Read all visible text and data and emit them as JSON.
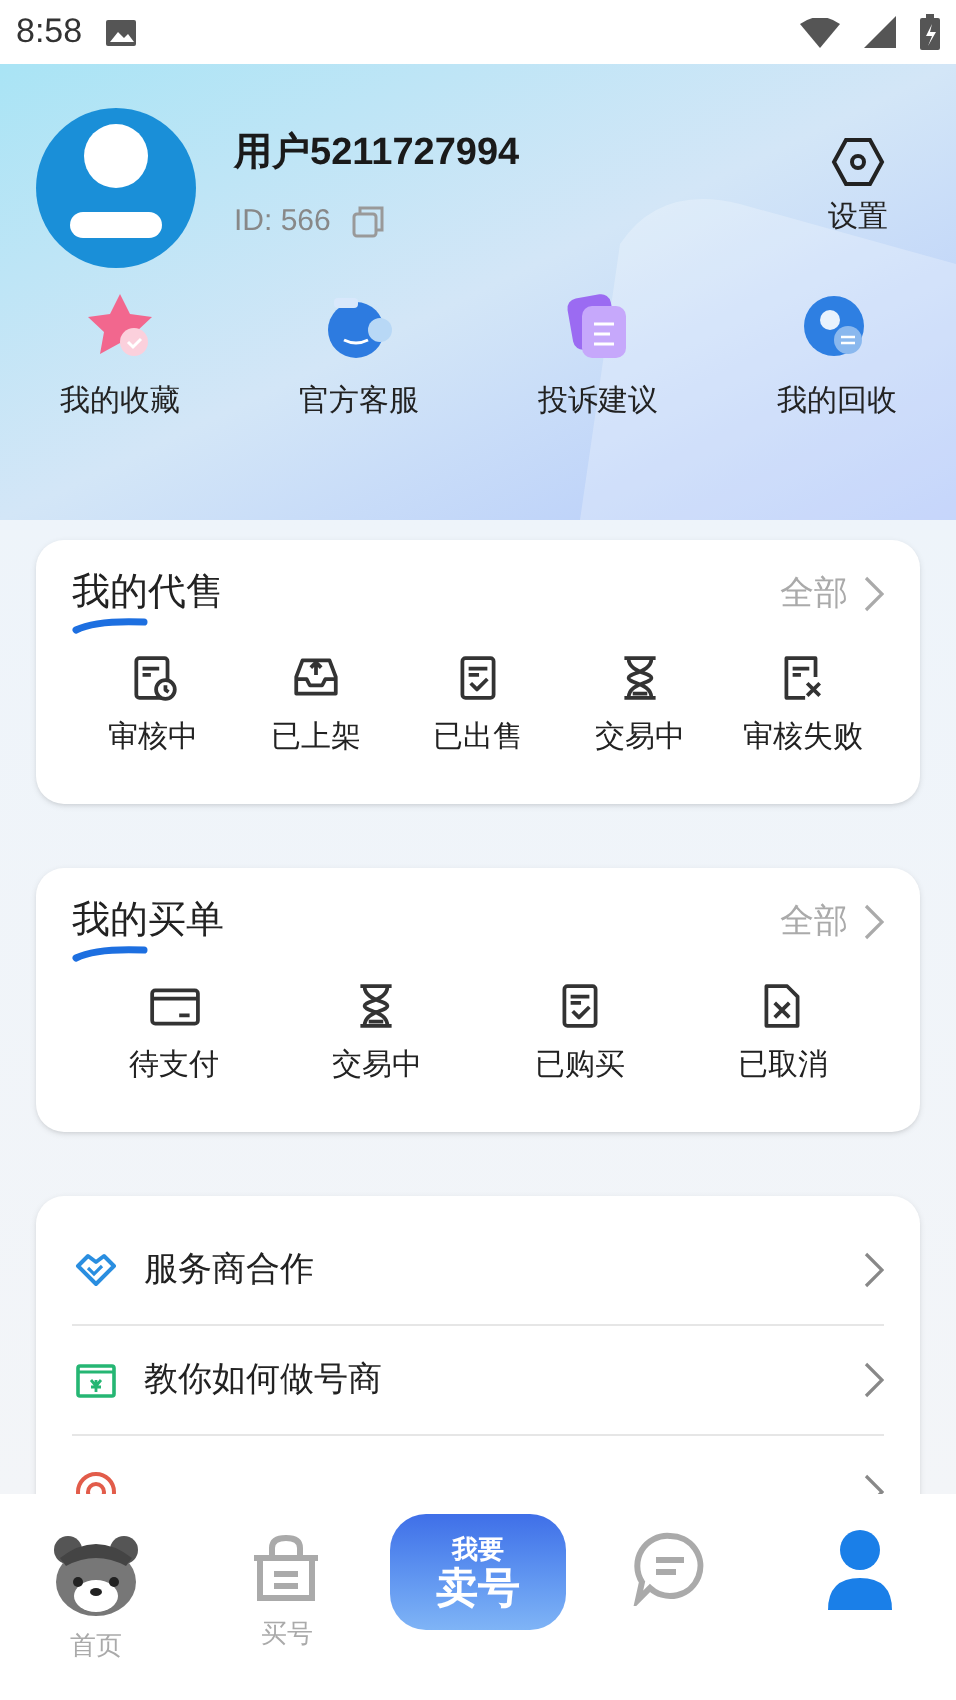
{
  "status_bar": {
    "time": "8:58"
  },
  "profile": {
    "username": "用户5211727994",
    "id_label": "ID: 566",
    "settings_label": "设置"
  },
  "shortcuts": [
    {
      "kind": "star",
      "label": "我的收藏"
    },
    {
      "kind": "service",
      "label": "官方客服"
    },
    {
      "kind": "feedback",
      "label": "投诉建议"
    },
    {
      "kind": "recycle",
      "label": "我的回收"
    }
  ],
  "sections": [
    {
      "title": "我的代售",
      "more": "全部",
      "items": [
        {
          "kind": "review",
          "label": "审核中"
        },
        {
          "kind": "upload",
          "label": "已上架"
        },
        {
          "kind": "check",
          "label": "已出售"
        },
        {
          "kind": "hourglass",
          "label": "交易中"
        },
        {
          "kind": "reject",
          "label": "审核失败"
        }
      ]
    },
    {
      "title": "我的买单",
      "more": "全部",
      "items": [
        {
          "kind": "card",
          "label": "待支付"
        },
        {
          "kind": "hourglass",
          "label": "交易中"
        },
        {
          "kind": "check",
          "label": "已购买"
        },
        {
          "kind": "cancel",
          "label": "已取消"
        }
      ]
    }
  ],
  "menu": [
    {
      "kind": "handshake",
      "label": "服务商合作"
    },
    {
      "kind": "money",
      "label": "教你如何做号商"
    },
    {
      "kind": "help"
    }
  ],
  "tab_bar": [
    {
      "kind": "mascot",
      "label": "首页",
      "selected": false
    },
    {
      "kind": "basket",
      "label": "买号",
      "selected": false
    },
    {
      "kind": "sell",
      "label": "卖号",
      "badge": "我要",
      "selected": false
    },
    {
      "kind": "chat",
      "selected": false
    },
    {
      "kind": "person",
      "selected": true
    }
  ]
}
